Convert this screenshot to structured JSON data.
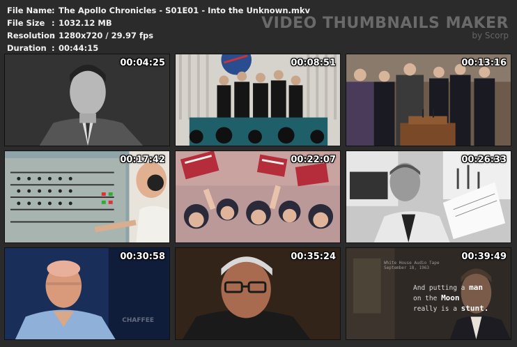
{
  "info": {
    "rows": [
      {
        "label": "File Name",
        "sep": ":",
        "value": "The Apollo Chronicles - S01E01 - Into the Unknown.mkv"
      },
      {
        "label": "File Size",
        "sep": ":",
        "value": "1032.12 MB"
      },
      {
        "label": "Resolution",
        "sep": ":",
        "value": "1280x720 / 29.97 fps"
      },
      {
        "label": "Duration",
        "sep": ":",
        "value": "00:44:15"
      }
    ]
  },
  "banner": {
    "title": "VIDEO THUMBNAILS MAKER",
    "subtitle": "by Scorp"
  },
  "thumbnails": [
    {
      "timestamp": "00:04:25"
    },
    {
      "timestamp": "00:08:51"
    },
    {
      "timestamp": "00:13:16"
    },
    {
      "timestamp": "00:17:42"
    },
    {
      "timestamp": "00:22:07"
    },
    {
      "timestamp": "00:26:33"
    },
    {
      "timestamp": "00:30:58"
    },
    {
      "timestamp": "00:35:24"
    },
    {
      "timestamp": "00:39:49"
    }
  ],
  "frame7_watermark": "CHAFFEE",
  "frame9_header": [
    "White House Audio Tape",
    "September 18, 1963"
  ],
  "frame9_caption": {
    "line1_a": "And putting a",
    "line1_b": "man",
    "line2_a": "on the",
    "line2_b": "Moon",
    "line3_a": "really is a",
    "line3_b": "stunt."
  },
  "colors": {
    "background": "#2b2b2b",
    "text": "#f2f2f2",
    "banner": "#6a6a6a"
  }
}
